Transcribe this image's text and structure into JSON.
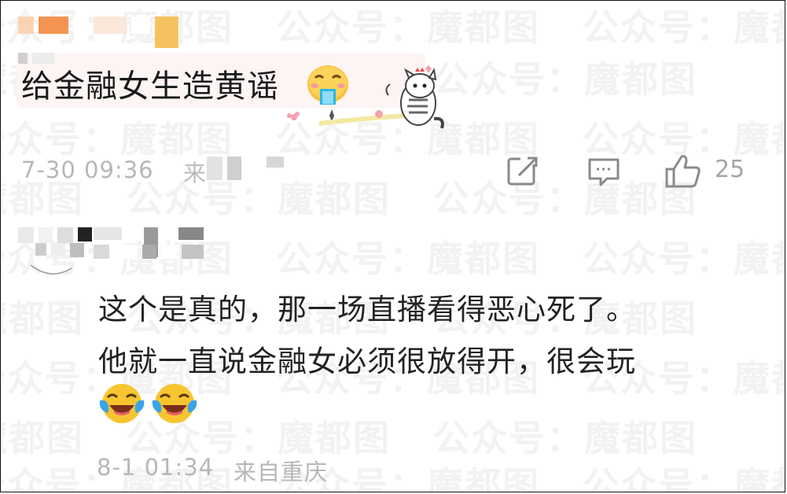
{
  "watermark": {
    "text": "公众号：魔都图"
  },
  "comments": [
    {
      "text": "给金融女生造黄谣",
      "timestamp": "7-30 09:36",
      "location_partial": "来",
      "likes": "25",
      "icons": [
        "share-icon",
        "reply-icon",
        "like-icon"
      ]
    },
    {
      "text_lines": [
        "这个是真的，那一场直播看得恶心死了。",
        "他就一直说金融女必须很放得开，很会玩"
      ],
      "timestamp": "8-1 01:34",
      "location": "来自重庆"
    }
  ],
  "colors": {
    "meta": "#b7b7b7",
    "text": "#1a1a1a",
    "bubble": "#fdf4f4",
    "emoji_yellow": "#f7c52f"
  }
}
